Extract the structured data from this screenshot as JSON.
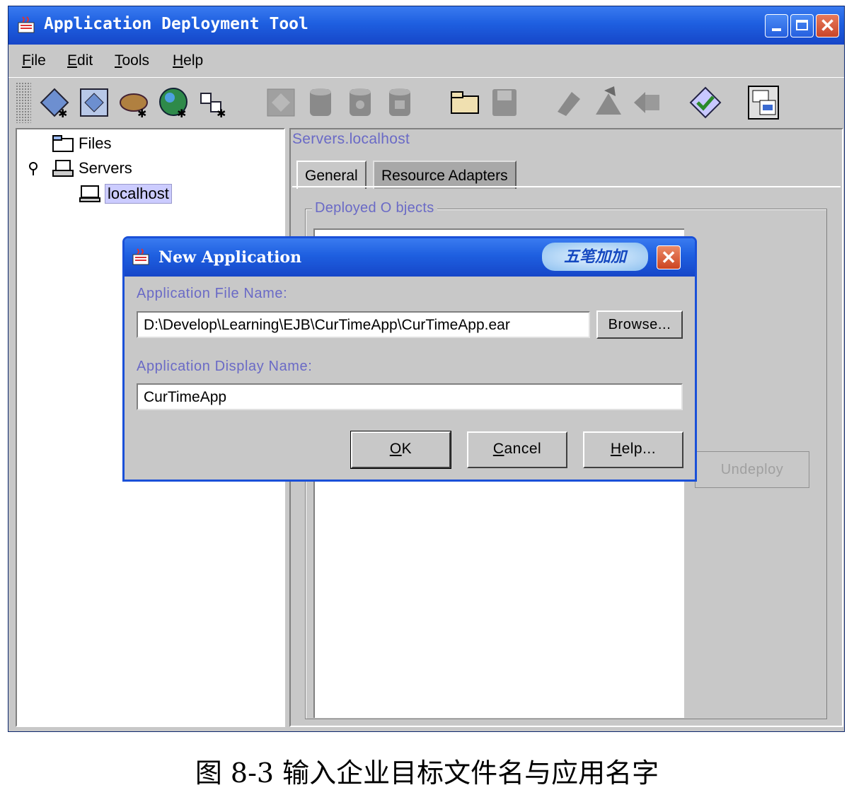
{
  "window": {
    "title": "Application Deployment Tool"
  },
  "menu": [
    {
      "first": "F",
      "rest": "ile"
    },
    {
      "first": "E",
      "rest": "dit"
    },
    {
      "first": "T",
      "rest": "ools"
    },
    {
      "first": "H",
      "rest": "elp"
    }
  ],
  "toolbar": {
    "icons": [
      "new-application-icon",
      "new-application-client-icon",
      "new-web-component-icon",
      "new-enterprise-bean-icon",
      "new-connector-icon",
      "open-icon",
      "add-icon",
      "add-server-icon",
      "add-database-icon",
      "open-folder-icon",
      "save-icon",
      "deploy-icon",
      "undeploy-icon",
      "return-icon",
      "verify-icon",
      "descriptor-viewer-icon"
    ]
  },
  "tree": {
    "files": "Files",
    "servers": "Servers",
    "localhost": "localhost"
  },
  "right": {
    "breadcrumb": "Servers.localhost",
    "tabs": [
      "General",
      "Resource Adapters"
    ],
    "group_label": "Deployed O bjects",
    "undeploy": "Undeploy"
  },
  "dialog": {
    "title": "New Application",
    "ime_badge": "五笔加加",
    "file_label": "Application File Name:",
    "file_value": "D:\\Develop\\Learning\\EJB\\CurTimeApp\\CurTimeApp.ear",
    "browse": "Browse...",
    "display_label": "Application Display Name:",
    "display_value": "CurTimeApp",
    "ok": {
      "first": "O",
      "rest": "K"
    },
    "cancel": {
      "first": "C",
      "rest": "ancel"
    },
    "help": {
      "first": "H",
      "rest": "elp..."
    }
  },
  "caption": "图 8-3 输入企业目标文件名与应用名字"
}
